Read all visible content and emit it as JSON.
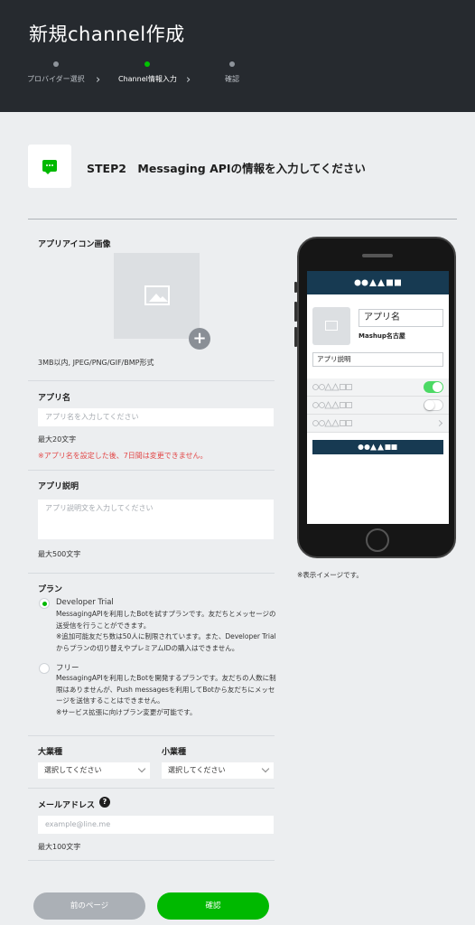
{
  "header": {
    "title": "新規channel作成",
    "steps": [
      {
        "label": "プロバイダー選択",
        "active": false
      },
      {
        "label": "Channel情報入力",
        "active": true
      },
      {
        "label": "確認",
        "active": false
      }
    ]
  },
  "step_banner": {
    "icon": "chat-bubble-icon",
    "heading": "STEP2　Messaging APIの情報を入力してください"
  },
  "form": {
    "app_icon": {
      "label": "アプリアイコン画像",
      "hint": "3MB以内, JPEG/PNG/GIF/BMP形式",
      "upload_icon": "image-placeholder-icon",
      "add_icon": "plus-icon",
      "add_symbol": "+"
    },
    "app_name": {
      "label": "アプリ名",
      "placeholder": "アプリ名を入力してください",
      "hint": "最大20文字",
      "warning": "※アプリ名を設定した後、7日間は変更できません。"
    },
    "app_description": {
      "label": "アプリ説明",
      "placeholder": "アプリ説明文を入力してください",
      "hint": "最大500文字"
    },
    "plan": {
      "label": "プラン",
      "options": [
        {
          "title": "Developer Trial",
          "selected": true,
          "description": "MessagingAPIを利用したBotを試すプランです。友だちとメッセージの送受信を行うことができます。\n※追加可能友だち数は50人に制限されています。また、Developer Trialからプランの切り替えやプレミアムIDの購入はできません。"
        },
        {
          "title": "フリー",
          "selected": false,
          "description": "MessagingAPIを利用したBotを開発するプランです。友だちの人数に制限はありませんが、Push messagesを利用してBotから友だちにメッセージを送信することはできません。\n※サービス拡張に向けプラン変更が可能です。"
        }
      ]
    },
    "category": {
      "large_label": "大業種",
      "large_value": "選択してください",
      "small_label": "小業種",
      "small_value": "選択してください"
    },
    "email": {
      "label": "メールアドレス",
      "help_icon": "question-icon",
      "help_symbol": "?",
      "placeholder": "example@line.me",
      "hint": "最大100文字"
    }
  },
  "buttons": {
    "prev_label": "前のページ",
    "confirm_label": "確認"
  },
  "preview": {
    "app_name": "アプリ名",
    "company": "Mashup名古屋",
    "description": "アプリ説明",
    "toggles": [
      true,
      false
    ],
    "caption": "※表示イメージです。"
  },
  "colors": {
    "header_bg": "#262a2f",
    "accent_green": "#00b900",
    "warning_red": "#e24646",
    "phone_header": "#173a52"
  }
}
